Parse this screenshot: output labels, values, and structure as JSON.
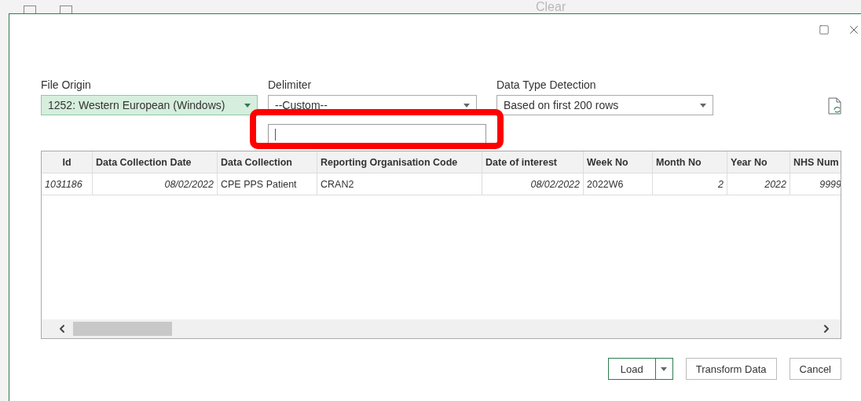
{
  "background_ribbon": {
    "label": "Clear"
  },
  "dialog": {
    "fields": [
      {
        "label": "File Origin",
        "value": "1252: Western European (Windows)",
        "highlighted": true
      },
      {
        "label": "Delimiter",
        "value": "--Custom--",
        "highlighted": false
      },
      {
        "label": "Data Type Detection",
        "value": "Based on first 200 rows",
        "highlighted": false
      }
    ],
    "custom_delimiter": {
      "focused": true
    },
    "table": {
      "columns": [
        {
          "label": "Id",
          "kind": "id"
        },
        {
          "label": "Data Collection Date",
          "kind": "date"
        },
        {
          "label": "Data Collection",
          "kind": "text"
        },
        {
          "label": "Reporting Organisation Code",
          "kind": "text"
        },
        {
          "label": "Date of interest",
          "kind": "date"
        },
        {
          "label": "Week No",
          "kind": "text"
        },
        {
          "label": "Month No",
          "kind": "number"
        },
        {
          "label": "Year No",
          "kind": "number"
        },
        {
          "label": "NHS Num",
          "kind": "number"
        }
      ],
      "rows": [
        [
          {
            "text": "1031186",
            "kind": "id"
          },
          {
            "text": "08/02/2022",
            "kind": "date"
          },
          {
            "text": "CPE PPS Patient",
            "kind": "text"
          },
          {
            "text": "CRAN2",
            "kind": "text"
          },
          {
            "text": "08/02/2022",
            "kind": "date"
          },
          {
            "text": "2022W6",
            "kind": "text"
          },
          {
            "text": "2",
            "kind": "number"
          },
          {
            "text": "2022",
            "kind": "number"
          },
          {
            "text": "9999",
            "kind": "number"
          }
        ]
      ]
    },
    "buttons": [
      {
        "label": "Load",
        "kind": "split",
        "primary": true
      },
      {
        "label": "Transform Data",
        "kind": "plain",
        "primary": false
      },
      {
        "label": "Cancel",
        "kind": "plain",
        "primary": false
      }
    ]
  }
}
